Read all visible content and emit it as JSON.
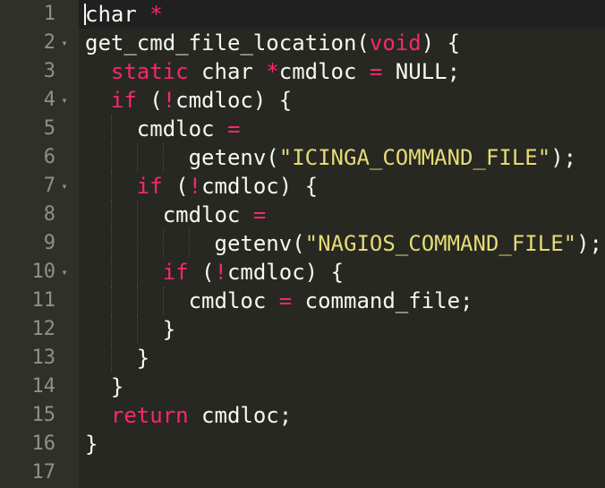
{
  "editor": {
    "colors": {
      "background": "#272822",
      "gutter": "#2f3129",
      "keyword": "#f92672",
      "string": "#e6db74",
      "text": "#f8f8f2",
      "line_number": "#8f908a"
    },
    "fold_icon": "chevron-down-icon",
    "lines": [
      {
        "num": "1",
        "indent": 0,
        "fold": false,
        "tokens": [
          {
            "t": "char ",
            "c": "plain"
          },
          {
            "t": "*",
            "c": "kw"
          }
        ]
      },
      {
        "num": "2",
        "indent": 0,
        "fold": true,
        "tokens": [
          {
            "t": "get_cmd_file_location(",
            "c": "plain"
          },
          {
            "t": "void",
            "c": "kw"
          },
          {
            "t": ") {",
            "c": "plain"
          }
        ]
      },
      {
        "num": "3",
        "indent": 1,
        "fold": false,
        "tokens": [
          {
            "t": "static",
            "c": "kw"
          },
          {
            "t": " char ",
            "c": "plain"
          },
          {
            "t": "*",
            "c": "kw"
          },
          {
            "t": "cmdloc ",
            "c": "plain"
          },
          {
            "t": "=",
            "c": "kw"
          },
          {
            "t": " NULL;",
            "c": "plain"
          }
        ]
      },
      {
        "num": "4",
        "indent": 1,
        "fold": true,
        "tokens": [
          {
            "t": "if",
            "c": "kw"
          },
          {
            "t": " (",
            "c": "plain"
          },
          {
            "t": "!",
            "c": "kw"
          },
          {
            "t": "cmdloc) {",
            "c": "plain"
          }
        ]
      },
      {
        "num": "5",
        "indent": 2,
        "fold": false,
        "tokens": [
          {
            "t": "cmdloc ",
            "c": "plain"
          },
          {
            "t": "=",
            "c": "kw"
          }
        ]
      },
      {
        "num": "6",
        "indent": 4,
        "fold": false,
        "tokens": [
          {
            "t": "getenv(",
            "c": "plain"
          },
          {
            "t": "\"ICINGA_COMMAND_FILE\"",
            "c": "str"
          },
          {
            "t": ");",
            "c": "plain"
          }
        ]
      },
      {
        "num": "7",
        "indent": 2,
        "fold": true,
        "tokens": [
          {
            "t": "if",
            "c": "kw"
          },
          {
            "t": " (",
            "c": "plain"
          },
          {
            "t": "!",
            "c": "kw"
          },
          {
            "t": "cmdloc) {",
            "c": "plain"
          }
        ]
      },
      {
        "num": "8",
        "indent": 3,
        "fold": false,
        "tokens": [
          {
            "t": "cmdloc ",
            "c": "plain"
          },
          {
            "t": "=",
            "c": "kw"
          }
        ]
      },
      {
        "num": "9",
        "indent": 5,
        "fold": false,
        "tokens": [
          {
            "t": "getenv(",
            "c": "plain"
          },
          {
            "t": "\"NAGIOS_COMMAND_FILE\"",
            "c": "str"
          },
          {
            "t": ");",
            "c": "plain"
          }
        ]
      },
      {
        "num": "10",
        "indent": 3,
        "fold": true,
        "tokens": [
          {
            "t": "if",
            "c": "kw"
          },
          {
            "t": " (",
            "c": "plain"
          },
          {
            "t": "!",
            "c": "kw"
          },
          {
            "t": "cmdloc) {",
            "c": "plain"
          }
        ]
      },
      {
        "num": "11",
        "indent": 4,
        "fold": false,
        "tokens": [
          {
            "t": "cmdloc ",
            "c": "plain"
          },
          {
            "t": "=",
            "c": "kw"
          },
          {
            "t": " command_file;",
            "c": "plain"
          }
        ]
      },
      {
        "num": "12",
        "indent": 3,
        "fold": false,
        "tokens": [
          {
            "t": "}",
            "c": "plain"
          }
        ]
      },
      {
        "num": "13",
        "indent": 2,
        "fold": false,
        "tokens": [
          {
            "t": "}",
            "c": "plain"
          }
        ]
      },
      {
        "num": "14",
        "indent": 1,
        "fold": false,
        "tokens": [
          {
            "t": "}",
            "c": "plain"
          }
        ]
      },
      {
        "num": "15",
        "indent": 1,
        "fold": false,
        "tokens": [
          {
            "t": "return",
            "c": "kw"
          },
          {
            "t": " cmdloc;",
            "c": "plain"
          }
        ]
      },
      {
        "num": "16",
        "indent": 0,
        "fold": false,
        "tokens": [
          {
            "t": "}",
            "c": "plain"
          }
        ]
      },
      {
        "num": "17",
        "indent": 0,
        "fold": false,
        "tokens": []
      }
    ]
  }
}
